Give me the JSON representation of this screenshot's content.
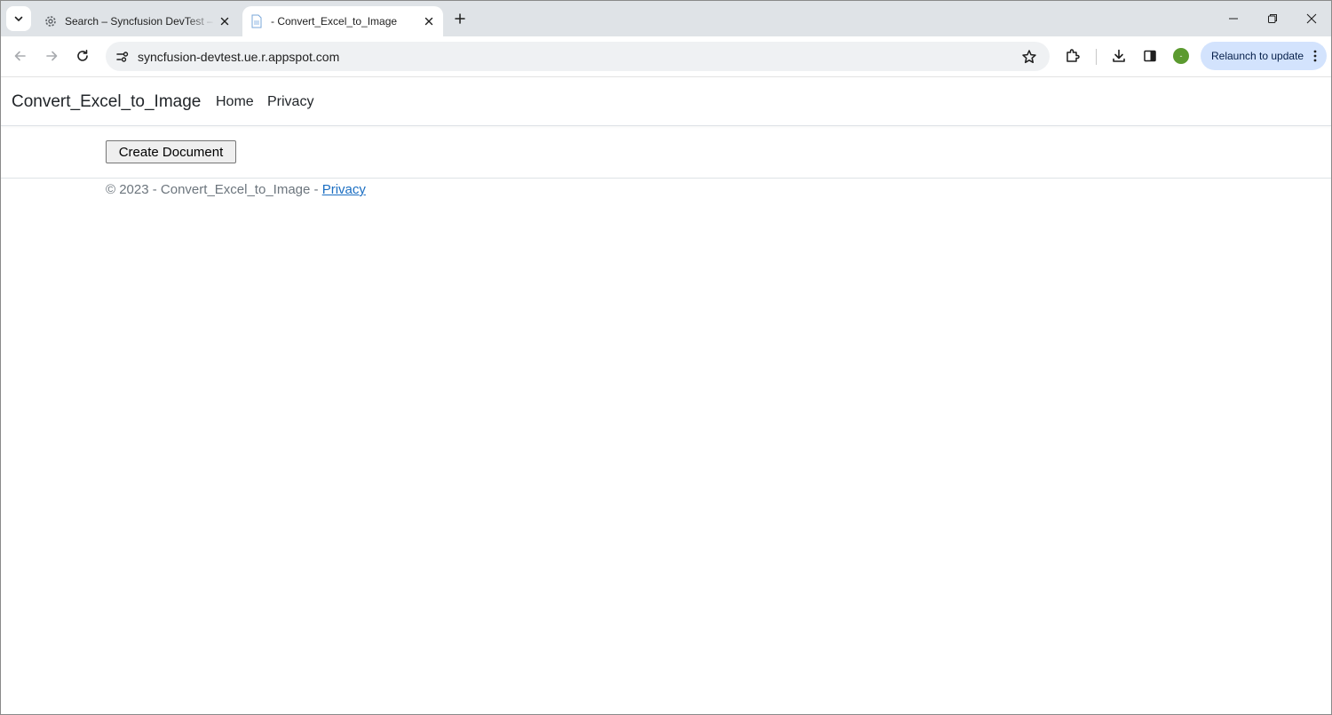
{
  "browser": {
    "tabs": [
      {
        "title": "Search – Syncfusion DevTest –",
        "favicon": "gear-icon",
        "active": false
      },
      {
        "title": "- Convert_Excel_to_Image",
        "favicon": "page-icon",
        "active": true
      }
    ],
    "address_bar": {
      "url": "syncfusion-devtest.ue.r.appspot.com"
    },
    "relaunch_label": "Relaunch to update",
    "profile_initial": "-",
    "colors": {
      "tabstrip": "#dfe3e7",
      "omnibox": "#eff1f3",
      "relaunch": "#d3e3fd",
      "profile": "#5b9a2f"
    }
  },
  "site": {
    "brand": "Convert_Excel_to_Image",
    "nav": [
      {
        "label": "Home"
      },
      {
        "label": "Privacy"
      }
    ]
  },
  "main": {
    "create_button_label": "Create Document"
  },
  "footer": {
    "text": "© 2023 - Convert_Excel_to_Image - ",
    "link_label": "Privacy",
    "link_color": "#1b6ec2"
  }
}
